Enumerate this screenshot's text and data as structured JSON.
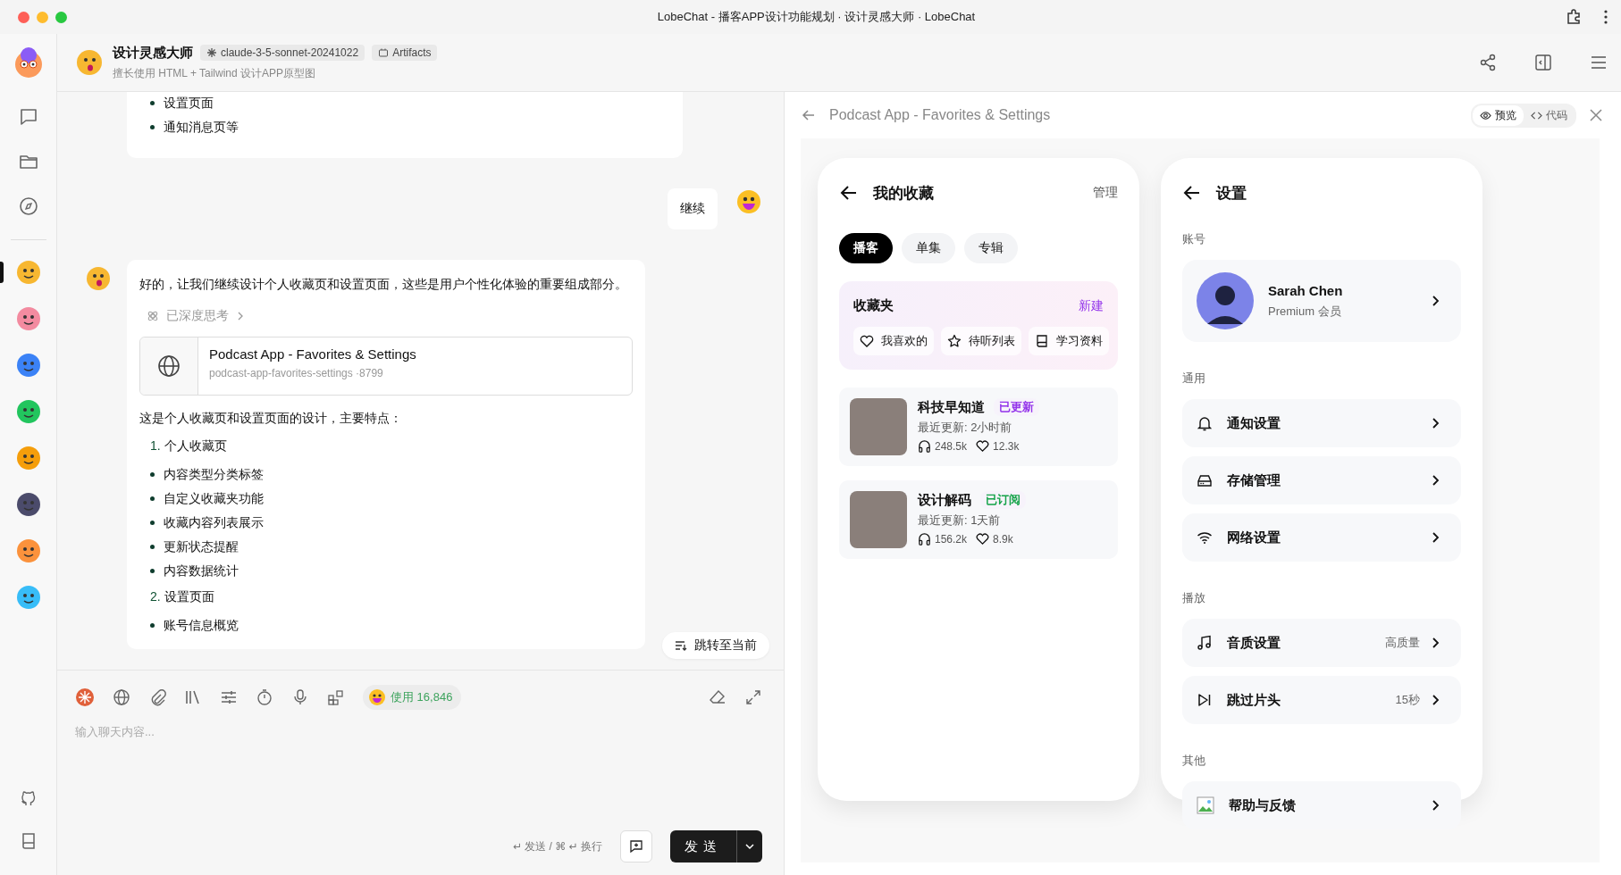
{
  "window": {
    "title": "LobeChat - 播客APP设计功能规划 · 设计灵感大师 · LobeChat"
  },
  "sidebar": {
    "agents": [
      {
        "selected": true,
        "color": "#f7b731"
      },
      {
        "selected": false,
        "color": "#f38ba0"
      },
      {
        "selected": false,
        "color": "#3b82f6"
      },
      {
        "selected": false,
        "color": "#22c55e"
      },
      {
        "selected": false,
        "color": "#f59e0b"
      },
      {
        "selected": false,
        "color": "#4b4b6b"
      },
      {
        "selected": false,
        "color": "#fb923c"
      },
      {
        "selected": false,
        "color": "#38bdf8"
      }
    ]
  },
  "chat_header": {
    "name": "设计灵感大师",
    "model": "claude-3-5-sonnet-20241022",
    "badge": "Artifacts",
    "description": "擅长使用 HTML + Tailwind 设计APP原型图"
  },
  "messages": [
    {
      "kind": "assistant_tail",
      "bullets": [
        "设置页面",
        "通知消息页等"
      ]
    },
    {
      "kind": "user",
      "text": "继续"
    },
    {
      "kind": "assistant",
      "intro": "好的，让我们继续设计个人收藏页和设置页面，这些是用户个性化体验的重要组成部分。",
      "thinking": "已深度思考",
      "artifact": {
        "title": "Podcast App - Favorites & Settings",
        "meta": "podcast-app-favorites-settings ·8799"
      },
      "summary": "这是个人收藏页和设置页面的设计，主要特点：",
      "sections": [
        {
          "number": "1.",
          "title": "个人收藏页",
          "bullets": [
            "内容类型分类标签",
            "自定义收藏夹功能",
            "收藏内容列表展示",
            "更新状态提醒",
            "内容数据统计"
          ]
        },
        {
          "number": "2.",
          "title": "设置页面",
          "bullets": [
            "账号信息概览"
          ]
        }
      ]
    }
  ],
  "jump_button": "跳转至当前",
  "input": {
    "usage": "使用 16,846",
    "placeholder": "输入聊天内容...",
    "hint": "↵ 发送 / ⌘ ↵ 换行",
    "send": "发送"
  },
  "artifact_panel": {
    "title": "Podcast App - Favorites & Settings",
    "view_tabs": [
      {
        "label": "预览",
        "selected": true
      },
      {
        "label": "代码",
        "selected": false
      }
    ]
  },
  "favorites_screen": {
    "title": "我的收藏",
    "action": "管理",
    "tabs": [
      {
        "label": "播客",
        "selected": true
      },
      {
        "label": "单集",
        "selected": false
      },
      {
        "label": "专辑",
        "selected": false
      }
    ],
    "folders": {
      "title": "收藏夹",
      "action": "新建",
      "items": [
        {
          "kind": "heart",
          "label": "我喜欢的"
        },
        {
          "kind": "star",
          "label": "待听列表"
        },
        {
          "kind": "book",
          "label": "学习资料"
        }
      ]
    },
    "podcasts": [
      {
        "title": "科技早知道",
        "status": "已更新",
        "color": "#9333ea",
        "updated": "最近更新: 2小时前",
        "listens": "248.5k",
        "likes": "12.3k"
      },
      {
        "title": "设计解码",
        "status": "已订阅",
        "color": "#16a34a",
        "updated": "最近更新: 1天前",
        "listens": "156.2k",
        "likes": "8.9k"
      }
    ]
  },
  "settings_screen": {
    "title": "设置",
    "account": {
      "label": "账号",
      "name": "Sarah Chen",
      "tier": "Premium 会员"
    },
    "groups": [
      {
        "label": "通用",
        "rows": [
          {
            "kind": "bell",
            "label": "通知设置"
          },
          {
            "kind": "storage",
            "label": "存储管理"
          },
          {
            "kind": "wifi",
            "label": "网络设置"
          }
        ]
      },
      {
        "label": "播放",
        "rows": [
          {
            "kind": "music",
            "label": "音质设置",
            "value": "高质量"
          },
          {
            "kind": "skip",
            "label": "跳过片头",
            "value": "15秒"
          }
        ]
      },
      {
        "label": "其他",
        "rows": [
          {
            "kind": "image",
            "label": "帮助与反馈"
          }
        ]
      }
    ]
  }
}
